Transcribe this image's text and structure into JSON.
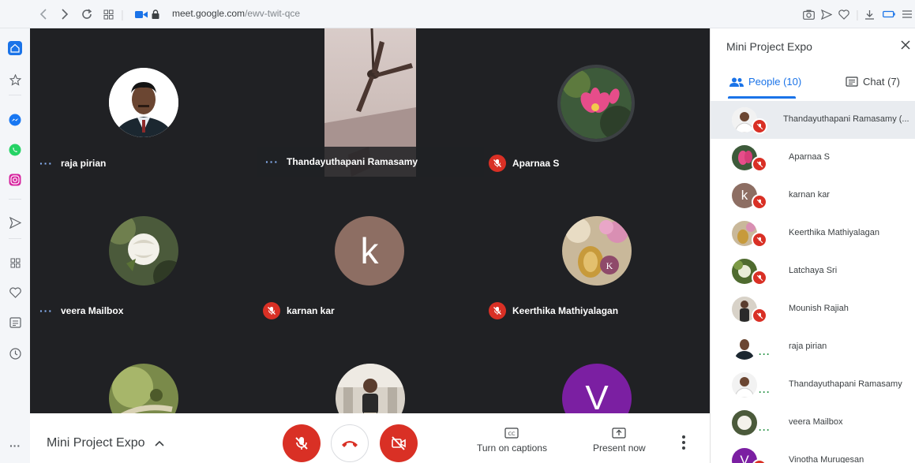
{
  "browser": {
    "url_host": "meet.google.com",
    "url_path": "/ewv-twit-qce"
  },
  "grid": {
    "tiles": [
      {
        "name": "raja pirian",
        "status": "speaking"
      },
      {
        "name": "Thandayuthapani Ramasamy",
        "status": "speaking"
      },
      {
        "name": "Aparnaa S",
        "status": "muted"
      },
      {
        "name": "veera Mailbox",
        "status": "speaking"
      },
      {
        "name": "karnan kar",
        "status": "muted",
        "initial": "k"
      },
      {
        "name": "Keerthika Mathiyalagan",
        "status": "muted"
      },
      {
        "name": "",
        "status": ""
      },
      {
        "name": "",
        "status": ""
      },
      {
        "name": "",
        "status": "",
        "initial": "V"
      }
    ]
  },
  "bottom_bar": {
    "meeting_title": "Mini Project Expo",
    "captions_label": "Turn on captions",
    "present_label": "Present now"
  },
  "panel": {
    "title": "Mini Project Expo",
    "tabs": {
      "people": "People (10)",
      "chat": "Chat (7)"
    },
    "people": [
      {
        "name": "Thandayuthapani Ramasamy (...",
        "status": "muted"
      },
      {
        "name": "Aparnaa S",
        "status": "muted"
      },
      {
        "name": "karnan kar",
        "status": "muted",
        "initial": "k"
      },
      {
        "name": "Keerthika Mathiyalagan",
        "status": "muted"
      },
      {
        "name": "Latchaya Sri",
        "status": "muted"
      },
      {
        "name": "Mounish Rajiah",
        "status": "muted"
      },
      {
        "name": "raja pirian",
        "status": "speaking"
      },
      {
        "name": "Thandayuthapani Ramasamy",
        "status": "speaking"
      },
      {
        "name": "veera Mailbox",
        "status": "speaking"
      },
      {
        "name": "Vinotha Murugesan",
        "status": "muted",
        "initial": "V"
      }
    ]
  },
  "colors": {
    "accent": "#1a73e8",
    "muted_red": "#d93025",
    "grid_bg": "#202124",
    "speaking_dots": "#8ab4f8"
  }
}
